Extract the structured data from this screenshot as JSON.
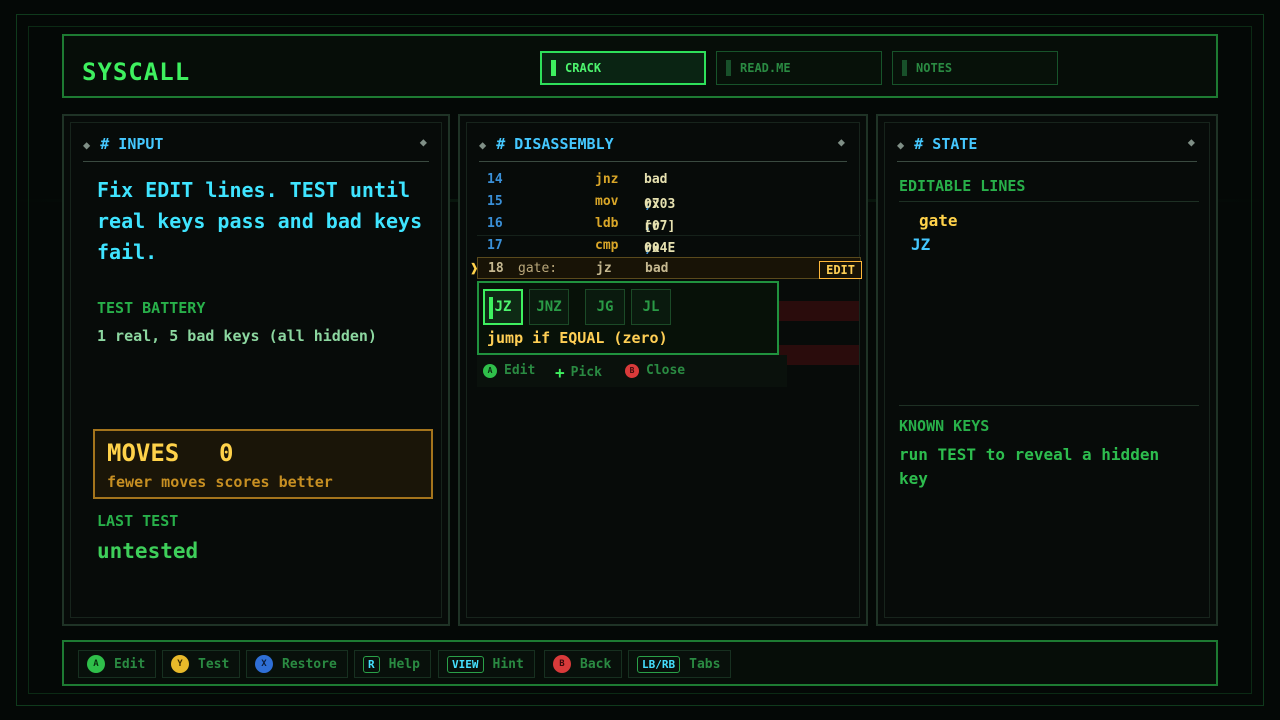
{
  "app": {
    "title": "SYSCALL"
  },
  "tabs": [
    {
      "label": "CRACK",
      "active": true
    },
    {
      "label": "READ.ME",
      "active": false
    },
    {
      "label": "NOTES",
      "active": false
    }
  ],
  "input_panel": {
    "title": "# INPUT",
    "intro": "Fix EDIT lines. TEST until real keys pass and bad keys fail.",
    "test_battery_label": "TEST BATTERY",
    "test_battery_text": "1 real, 5 bad keys (all hidden)",
    "moves_label": "MOVES",
    "moves_value": "0",
    "moves_sub": "fewer moves scores better",
    "last_test_label": "LAST TEST",
    "last_test_value": "untested"
  },
  "disassembly_panel": {
    "title": "# DISASSEMBLY",
    "lines": [
      {
        "num": "14",
        "label": "",
        "op": "jnz",
        "arg1": "bad",
        "arg2": ""
      },
      {
        "num": "15",
        "label": "",
        "op": "mov",
        "arg1": "r7",
        "arg2": "0x03"
      },
      {
        "num": "16",
        "label": "",
        "op": "ldb",
        "arg1": "r0",
        "arg2": "[r7]"
      },
      {
        "num": "17",
        "label": "",
        "op": "cmp",
        "arg1": "r0",
        "arg2": "0x4E"
      }
    ],
    "selected_line": {
      "num": "18",
      "label": "gate:",
      "op": "jz",
      "arg1": "bad",
      "badge": "EDIT"
    },
    "picker": {
      "options": [
        "JZ",
        "JNZ",
        "JG",
        "JL"
      ],
      "selected": "JZ",
      "description": "jump if EQUAL (zero)",
      "hints": [
        {
          "btn": "A",
          "label": "Edit"
        },
        {
          "btn": "+",
          "label": "Pick"
        },
        {
          "btn": "B",
          "label": "Close"
        }
      ]
    }
  },
  "state_panel": {
    "title": "# STATE",
    "editable_label": "EDITABLE LINES",
    "editable_items": [
      "gate",
      "JZ"
    ],
    "known_label": "KNOWN KEYS",
    "known_text": "run TEST to reveal a hidden key"
  },
  "footer": [
    {
      "btn": "A",
      "label": "Edit"
    },
    {
      "btn": "Y",
      "label": "Test"
    },
    {
      "btn": "X",
      "label": "Restore"
    },
    {
      "btn": "R",
      "label": "Help"
    },
    {
      "btn": "VIEW",
      "label": "Hint"
    },
    {
      "btn": "B",
      "label": "Back"
    },
    {
      "btn": "LB/RB",
      "label": "Tabs"
    }
  ],
  "colors": {
    "accent_green": "#3ef05f",
    "accent_cyan": "#3fe4ff",
    "accent_gold": "#ffd24a",
    "accent_red": "#d93a3a"
  },
  "icons": {
    "panel_corner": "diamond-icon",
    "cursor": "cursor-icon",
    "pick": "plus-icon"
  }
}
